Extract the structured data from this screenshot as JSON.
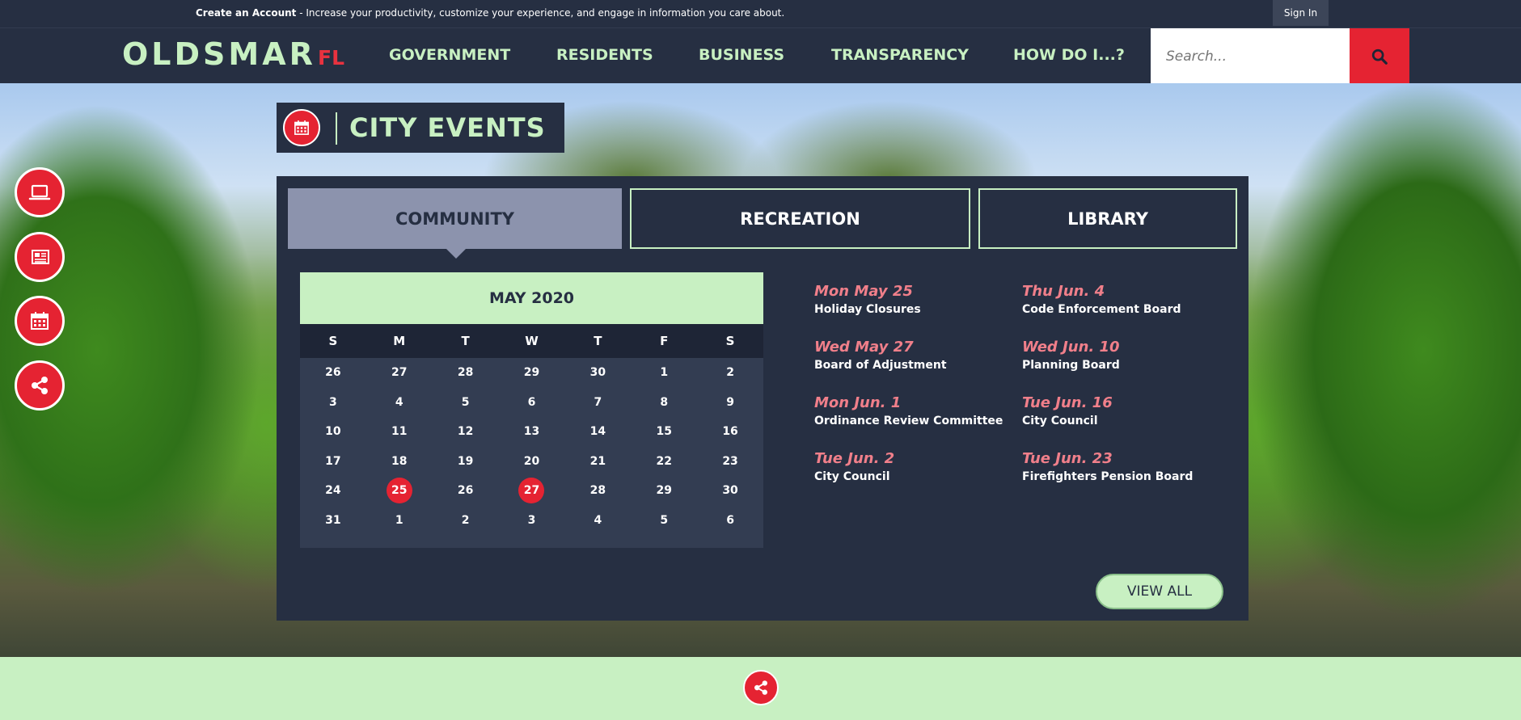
{
  "topbar": {
    "create_account": "Create an Account",
    "create_account_desc": " - Increase your productivity, customize your experience, and engage in information you care about.",
    "sign_in": "Sign In"
  },
  "header": {
    "logo": "OLDSMAR",
    "logo_suffix": "FL",
    "nav": [
      "GOVERNMENT",
      "RESIDENTS",
      "BUSINESS",
      "TRANSPARENCY",
      "HOW DO I...?"
    ],
    "search_placeholder": "Search..."
  },
  "side_buttons": [
    "laptop-icon",
    "newspaper-icon",
    "calendar-icon",
    "share-icon"
  ],
  "events": {
    "title": "CITY EVENTS",
    "tabs": [
      "COMMUNITY",
      "RECREATION",
      "LIBRARY"
    ],
    "active_tab": "COMMUNITY",
    "calendar": {
      "month": "MAY 2020",
      "dow": [
        "S",
        "M",
        "T",
        "W",
        "T",
        "F",
        "S"
      ],
      "weeks": [
        [
          "26",
          "27",
          "28",
          "29",
          "30",
          "1",
          "2"
        ],
        [
          "3",
          "4",
          "5",
          "6",
          "7",
          "8",
          "9"
        ],
        [
          "10",
          "11",
          "12",
          "13",
          "14",
          "15",
          "16"
        ],
        [
          "17",
          "18",
          "19",
          "20",
          "21",
          "22",
          "23"
        ],
        [
          "24",
          "25",
          "26",
          "27",
          "28",
          "29",
          "30"
        ],
        [
          "31",
          "1",
          "2",
          "3",
          "4",
          "5",
          "6"
        ]
      ],
      "highlighted": [
        "25",
        "27"
      ]
    },
    "list_left": [
      {
        "date": "Mon May 25",
        "name": "Holiday Closures"
      },
      {
        "date": "Wed May 27",
        "name": "Board of Adjustment"
      },
      {
        "date": "Mon Jun. 1",
        "name": "Ordinance Review Committee"
      },
      {
        "date": "Tue Jun. 2",
        "name": "City Council"
      }
    ],
    "list_right": [
      {
        "date": "Thu Jun. 4",
        "name": "Code Enforcement Board"
      },
      {
        "date": "Wed Jun. 10",
        "name": "Planning Board"
      },
      {
        "date": "Tue Jun. 16",
        "name": "City Council"
      },
      {
        "date": "Tue Jun. 23",
        "name": "Firefighters Pension Board"
      }
    ],
    "view_all": "VIEW ALL"
  },
  "colors": {
    "navy": "#262f42",
    "mint": "#c8f0c2",
    "red": "#e52332",
    "event_date": "#f07f8a"
  }
}
